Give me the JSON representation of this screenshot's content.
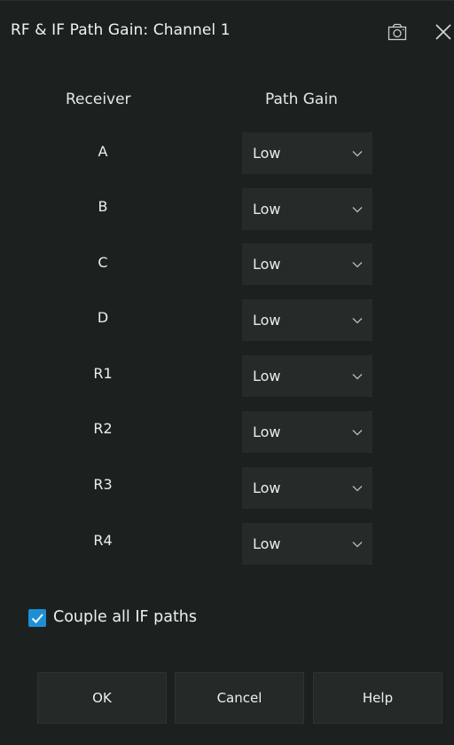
{
  "dialog": {
    "title": "RF & IF Path Gain: Channel 1"
  },
  "headers": {
    "receiver": "Receiver",
    "path_gain": "Path Gain"
  },
  "rows": [
    {
      "receiver": "A",
      "gain": "Low"
    },
    {
      "receiver": "B",
      "gain": "Low"
    },
    {
      "receiver": "C",
      "gain": "Low"
    },
    {
      "receiver": "D",
      "gain": "Low"
    },
    {
      "receiver": "R1",
      "gain": "Low"
    },
    {
      "receiver": "R2",
      "gain": "Low"
    },
    {
      "receiver": "R3",
      "gain": "Low"
    },
    {
      "receiver": "R4",
      "gain": "Low"
    }
  ],
  "couple": {
    "label": "Couple all IF paths",
    "checked": true
  },
  "buttons": {
    "ok": "OK",
    "cancel": "Cancel",
    "help": "Help"
  },
  "icons": {
    "camera": "camera-icon",
    "close": "close-icon",
    "chevron": "chevron-down-icon",
    "check": "checkmark-icon"
  },
  "colors": {
    "background": "#1c2120",
    "dropdown_bg": "#262b2a",
    "button_bg": "#252a29",
    "accent": "#1e8fd4",
    "text": "#e8eaea"
  }
}
